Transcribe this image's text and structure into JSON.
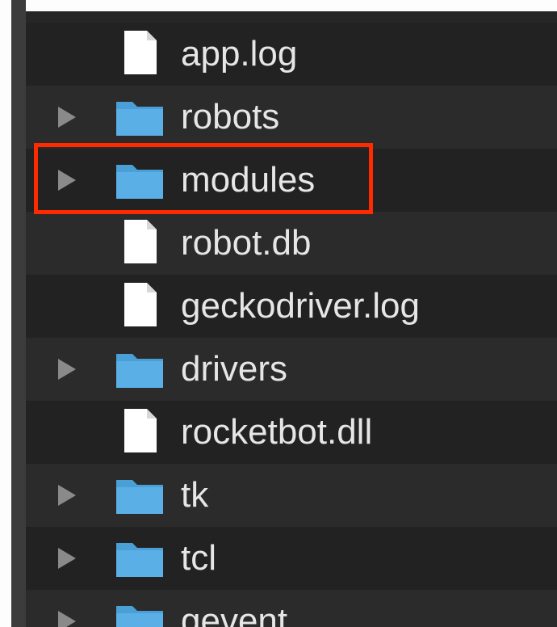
{
  "file_list": {
    "items": [
      {
        "name": "app.log",
        "kind": "file",
        "icon": "file-icon"
      },
      {
        "name": "robots",
        "kind": "folder",
        "icon": "folder-icon"
      },
      {
        "name": "modules",
        "kind": "folder",
        "icon": "folder-icon",
        "highlighted": true
      },
      {
        "name": "robot.db",
        "kind": "file",
        "icon": "file-icon"
      },
      {
        "name": "geckodriver.log",
        "kind": "file",
        "icon": "file-icon"
      },
      {
        "name": "drivers",
        "kind": "folder",
        "icon": "folder-icon"
      },
      {
        "name": "rocketbot.dll",
        "kind": "file",
        "icon": "file-icon"
      },
      {
        "name": "tk",
        "kind": "folder",
        "icon": "folder-icon"
      },
      {
        "name": "tcl",
        "kind": "folder",
        "icon": "folder-icon"
      },
      {
        "name": "gevent",
        "kind": "folder",
        "icon": "folder-icon"
      }
    ]
  },
  "colors": {
    "folder": "#5ab0e6",
    "highlight": "#ff2a00",
    "text": "#e6e6e6"
  }
}
